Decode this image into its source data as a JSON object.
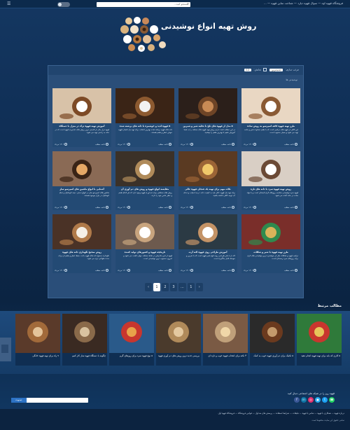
{
  "topbar": {
    "links": "فروشگاه قهوه اوه — سوال قهوه دیارد — شناخت ساین قهوه — ...",
    "search_placeholder": "جستجو کنید...",
    "menu_symbol": "☰"
  },
  "header": {
    "title": "روش تهیه انواع نوشیدنی"
  },
  "filter": {
    "label": "مرتب سازی:",
    "sort_value": "جدیدترین",
    "view_label": "نمایش:",
    "count": "12"
  },
  "section_label": "نوشیدنی ها",
  "cards": [
    {
      "title": "طرز تهیه قهوه کافه اسپرسو به روش ساده",
      "excerpt": "این کافی از قهوه های ترکیبی است که با طعم متفاوت شیر و خامه تهیه می شود و بسیار محبوب است.",
      "more": "ادامه مطلب",
      "date": "۱۴۰۲ مرداد"
    },
    {
      "title": "۵ مدل از قهوه های تلخ با تخلیه شیر و شیرین",
      "excerpt": "در این مطلب قصد داریم روش تهیه قهوه های مختلف را به شما آموزش دهیم تا بهترین طعم را بچشید.",
      "more": "ادامه مطلب",
      "date": "۱۴۰۲ مرداد"
    },
    {
      "title": "۵ قهوه لذیذ و خوشمزه با دانه های برشته شده",
      "excerpt": "دانه های قهوه برشته شده بهترین انتخاب برای تهیه یک فنجان قهوه خوش عطر و طعم هستند.",
      "more": "ادامه مطلب",
      "date": "۱۴۰۲ مرداد"
    },
    {
      "title": "آموزش تهیه قهوه ترک در منزل با دستگاه",
      "excerpt": "قهوه ترک یکی از قدیمی ترین روش های دم آوری قهوه است که در خانه به راحتی تهیه می شود.",
      "more": "ادامه مطلب",
      "date": "۱۴۰۲ مرداد"
    },
    {
      "title": "روش تهیه قهوه سرد با دانه های تازه",
      "excerpt": "قهوه سرد نوشیدنی مناسب روزهای گرم تابستان است و با مواد ساده در خانه آماده می شود.",
      "more": "ادامه مطلب",
      "date": "۱۴۰۲ مرداد"
    },
    {
      "title": "نکات مهم برای تهیه یک فنجان قهوه عالی",
      "excerpt": "برای تهیه یک قهوه عالی باید به کیفیت دانه، درجه آسیاب و دمای آب توجه کافی داشته باشید.",
      "more": "ادامه مطلب",
      "date": "۱۴۰۲ مرداد"
    },
    {
      "title": "مقایسه انواع قهوه و روش های دم آوری آن",
      "excerpt": "روش های مختلفی برای دم آوری قهوه وجود دارد که هر کدام طعم و عطر خاص خود را دارند.",
      "more": "ادامه مطلب",
      "date": "۱۴۰۲ مرداد"
    },
    {
      "title": "آشنایی با انواع ماشین های اسپرسو ساز",
      "excerpt": "ماشین های اسپرسو ساز در انواع دستی، نیمه اتوماتیک و تمام اتوماتیک در بازار موجود هستند.",
      "more": "ادامه مطلب",
      "date": "۱۴۰۲ مرداد"
    },
    {
      "title": "طرز تهیه قهوه با شیر و شکلات",
      "excerpt": "ترکیب قهوه و شکلات یکی از خوشمزه ترین نوشیدنی های گرم برای روزهای سرد زمستان است.",
      "more": "ادامه مطلب",
      "date": "۱۴۰۲ مرداد"
    },
    {
      "title": "آموزش طراحی روی قهوه لاته آرت",
      "excerpt": "لاته آرت هنر طراحی روی فوم شیر قهوه است که با تمرین و حوصله قابل یادگیری است.",
      "more": "ادامه مطلب",
      "date": "۱۴۰۲ مرداد"
    },
    {
      "title": "تاریخچه قهوه و کشورهای تولید کننده",
      "excerpt": "قهوه از قرن ها پیش در نقاط مختلف جهان کشت می شود و امروزه محبوب ترین نوشیدنی است.",
      "more": "ادامه مطلب",
      "date": "۱۴۰۲ مرداد"
    },
    {
      "title": "روش صحیح نگهداری دانه های قهوه",
      "excerpt": "نگهداری صحیح دانه های قهوه باعث حفظ عطر و طعم آن برای مدت طولانی تری می شود.",
      "more": "ادامه مطلب",
      "date": "۱۴۰۲ مرداد"
    }
  ],
  "pager": {
    "prev": "‹",
    "pages": [
      "1",
      "2",
      "3",
      "...",
      "1"
    ],
    "next": "›"
  },
  "related": {
    "heading": "مطالب مرتبط",
    "items": [
      "۵ کاری که باید برای تهیه قهوه انجام دهید",
      "۵ تکنیک برای دم آوری قهوه خوب به کمک",
      "۴ نکته برای انتخاب قهوه خوب و تازه ای",
      "بررسی جدید ترین روش های دم آوری قهوه",
      "۵ نوع قهوه سرد برای روزهای گرم",
      "چگونه با دستگاه قهوه ساز کار کنیم",
      "۷ راه برای تهیه قهوه خانگی"
    ]
  },
  "social": {
    "text": "قهوه روز را در شبکه های اجتماعی دنبال کنید",
    "icons": [
      "f",
      "in",
      "◎",
      "●",
      "t",
      "☎"
    ]
  },
  "newsletter": {
    "button": "عضویت"
  },
  "footer": {
    "menu": "درباره قهوه — همکاری با قهوه — تماس با قهوه — تبلیغات — شرایط استفاده — پرسش های متداول — قوانین فروشگاه — فروشگاه قهوه اول",
    "copy": "تمامی حقوق این سایت محفوظ است"
  }
}
